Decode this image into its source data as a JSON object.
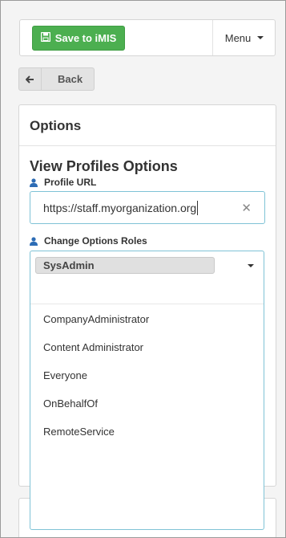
{
  "toolbar": {
    "save_label": "Save to iMIS",
    "menu_label": "Menu"
  },
  "back": {
    "label": "Back"
  },
  "panel": {
    "header": "Options",
    "section_title": "View Profiles Options",
    "profile_url": {
      "label": "Profile URL",
      "value": "https://staff.myorganization.org"
    },
    "roles": {
      "label": "Change Options Roles",
      "selected_tag": "SysAdmin",
      "options": [
        "CompanyAdministrator",
        "Content Administrator",
        "Everyone",
        "OnBehalfOf",
        "RemoteService"
      ]
    }
  },
  "colors": {
    "save_green": "#4caf50",
    "focus_blue": "#7fc3d6",
    "label_icon_blue": "#2d6cb5"
  },
  "icons": {
    "save": "floppy-disk-icon",
    "menu": "caret-down-icon",
    "back": "arrow-left-icon",
    "label": "user-icon",
    "clear": "close-icon",
    "dropdown": "caret-down-icon"
  }
}
